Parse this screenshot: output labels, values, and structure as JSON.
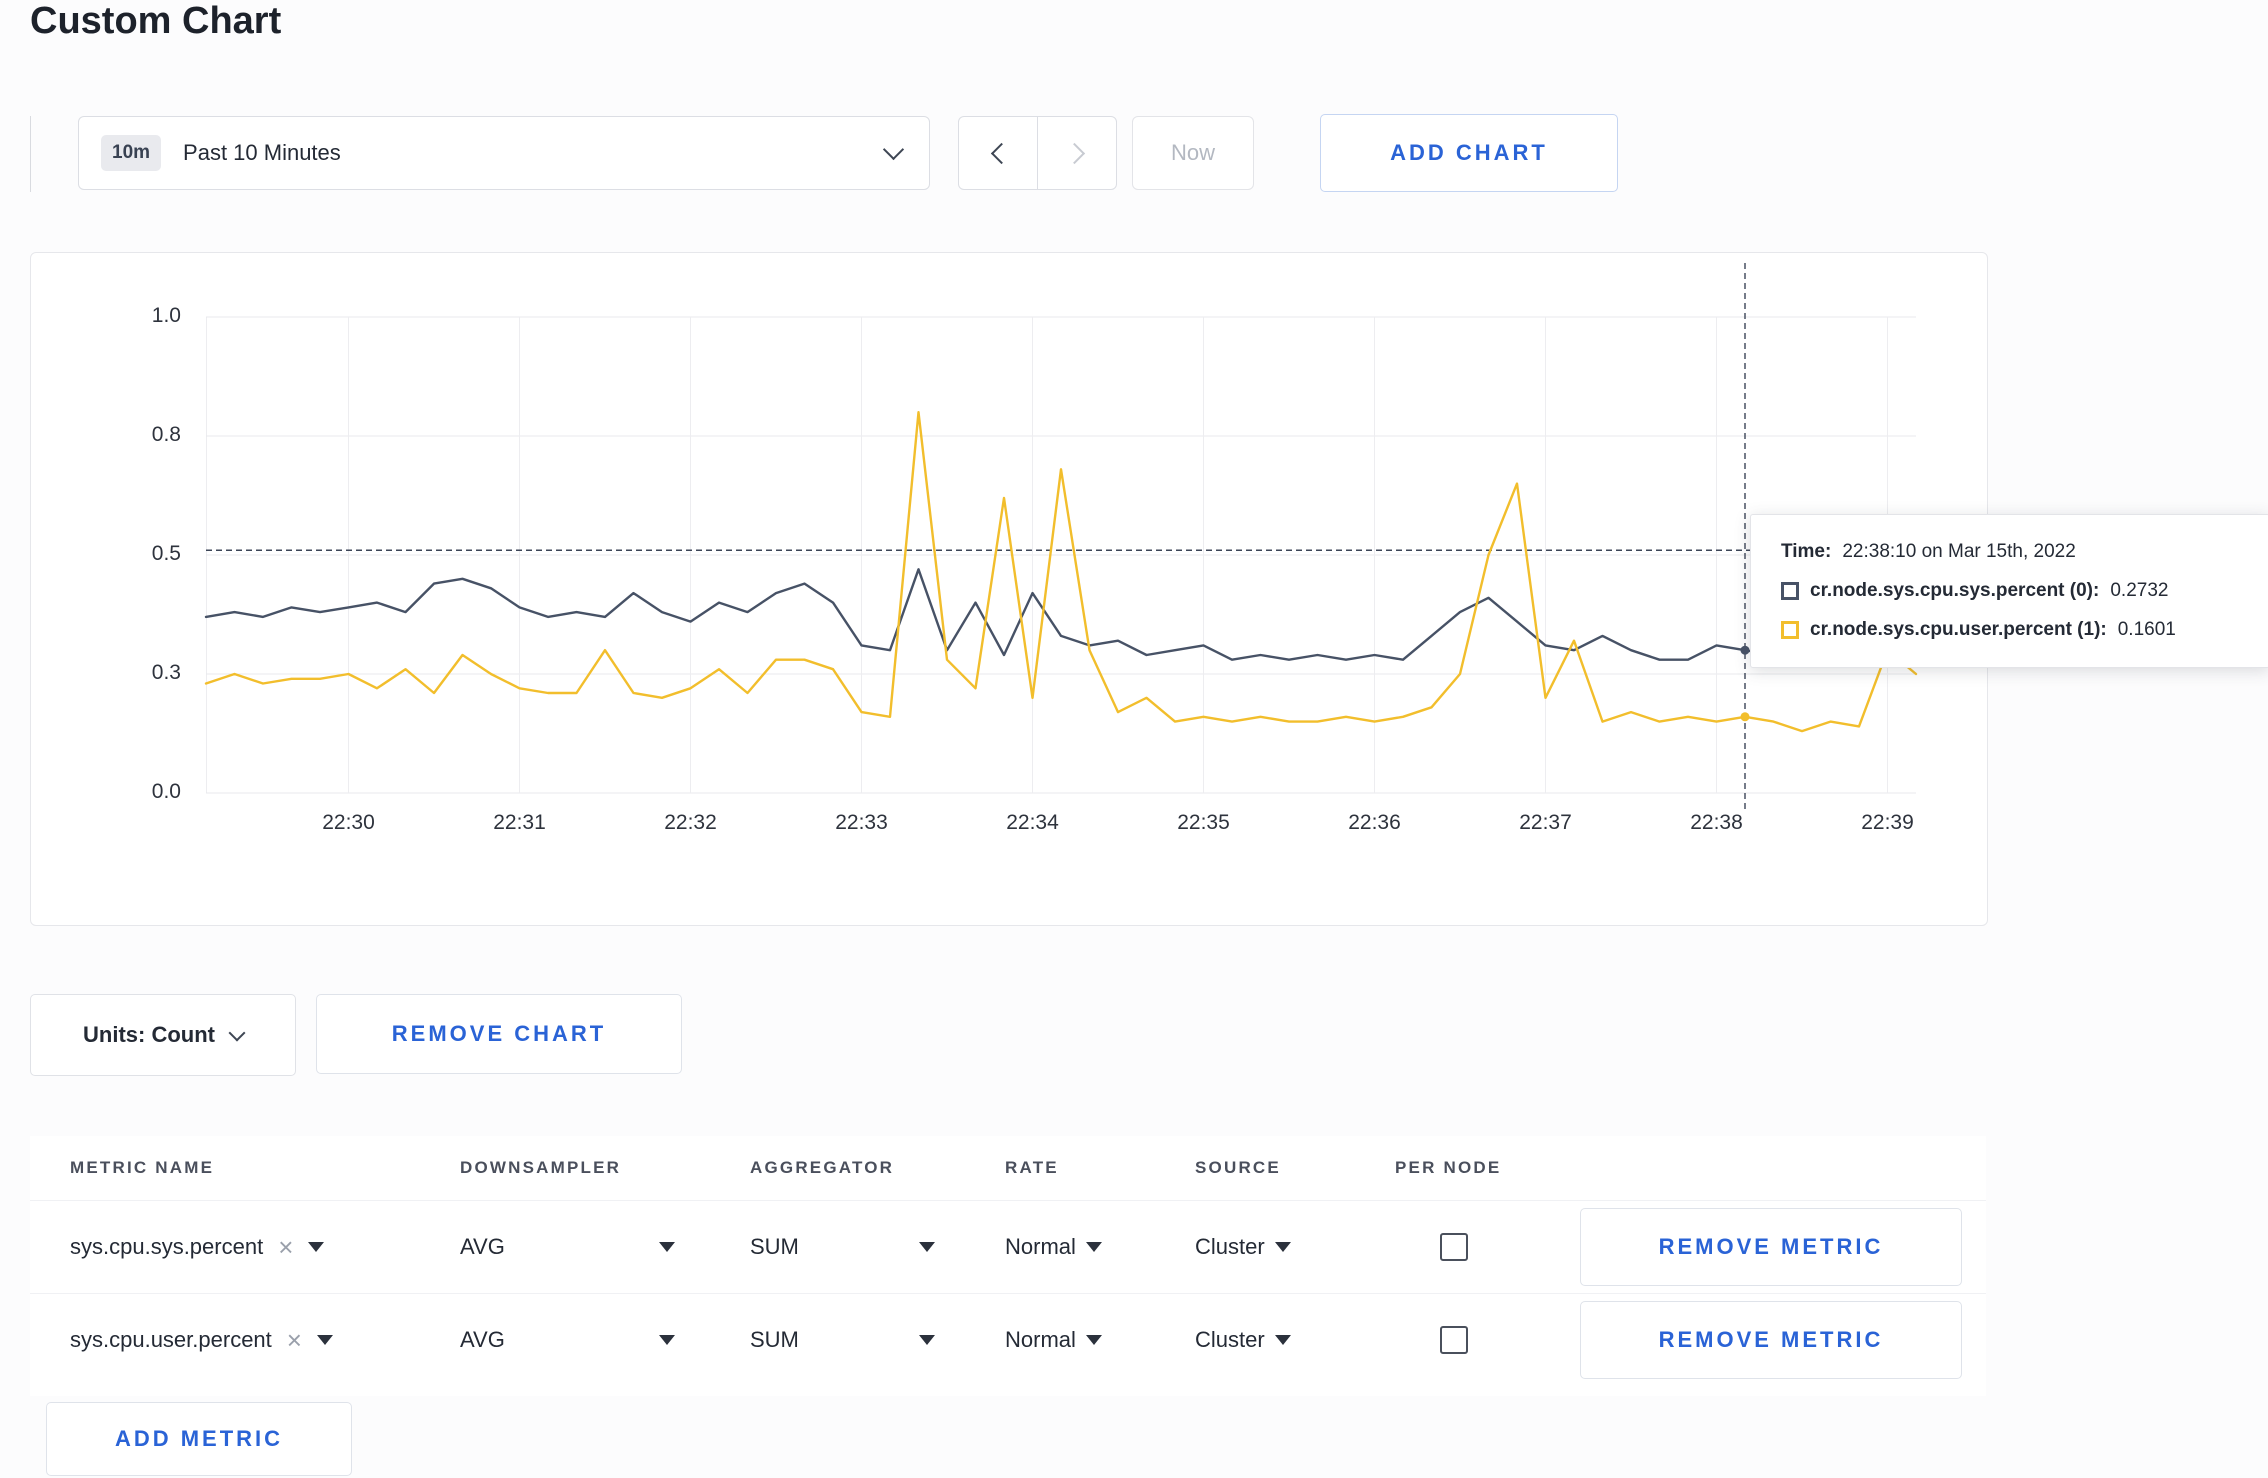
{
  "page": {
    "title": "Custom Chart"
  },
  "toolbar": {
    "time_badge": "10m",
    "time_label": "Past 10 Minutes",
    "now_label": "Now",
    "add_chart_label": "ADD CHART"
  },
  "chart_controls": {
    "units_label": "Units: Count",
    "remove_chart_label": "REMOVE CHART"
  },
  "chart_data": {
    "type": "line",
    "title": "",
    "xlabel": "",
    "ylabel": "",
    "ylim": [
      0,
      1
    ],
    "grid": true,
    "legend_position": "none",
    "x_start_time": "22:29:10",
    "x_interval_seconds": 10,
    "y_ticks": [
      {
        "v": 0,
        "label": "0.0"
      },
      {
        "v": 0.25,
        "label": "0.3"
      },
      {
        "v": 0.5,
        "label": "0.5"
      },
      {
        "v": 0.75,
        "label": "0.8"
      },
      {
        "v": 1,
        "label": "1.0"
      }
    ],
    "x_ticks": [
      {
        "i": 5,
        "label": "22:30"
      },
      {
        "i": 11,
        "label": "22:31"
      },
      {
        "i": 17,
        "label": "22:32"
      },
      {
        "i": 23,
        "label": "22:33"
      },
      {
        "i": 29,
        "label": "22:34"
      },
      {
        "i": 35,
        "label": "22:35"
      },
      {
        "i": 41,
        "label": "22:36"
      },
      {
        "i": 47,
        "label": "22:37"
      },
      {
        "i": 53,
        "label": "22:38"
      },
      {
        "i": 59,
        "label": "22:39"
      }
    ],
    "series": [
      {
        "name": "cr.node.sys.cpu.sys.percent",
        "color": "#475266",
        "values": [
          0.37,
          0.38,
          0.37,
          0.39,
          0.38,
          0.39,
          0.4,
          0.38,
          0.44,
          0.45,
          0.43,
          0.39,
          0.37,
          0.38,
          0.37,
          0.42,
          0.38,
          0.36,
          0.4,
          0.38,
          0.42,
          0.44,
          0.4,
          0.31,
          0.3,
          0.47,
          0.3,
          0.4,
          0.29,
          0.42,
          0.33,
          0.31,
          0.32,
          0.29,
          0.3,
          0.31,
          0.28,
          0.29,
          0.28,
          0.29,
          0.28,
          0.29,
          0.28,
          0.33,
          0.38,
          0.41,
          0.36,
          0.31,
          0.3,
          0.33,
          0.3,
          0.28,
          0.28,
          0.31,
          0.3,
          0.29,
          0.31,
          0.3,
          0.31,
          0.3,
          0.31
        ]
      },
      {
        "name": "cr.node.sys.cpu.user.percent",
        "color": "#f2be2c",
        "values": [
          0.23,
          0.25,
          0.23,
          0.24,
          0.24,
          0.25,
          0.22,
          0.26,
          0.21,
          0.29,
          0.25,
          0.22,
          0.21,
          0.21,
          0.3,
          0.21,
          0.2,
          0.22,
          0.26,
          0.21,
          0.28,
          0.28,
          0.26,
          0.17,
          0.16,
          0.8,
          0.28,
          0.22,
          0.62,
          0.2,
          0.68,
          0.3,
          0.17,
          0.2,
          0.15,
          0.16,
          0.15,
          0.16,
          0.15,
          0.15,
          0.16,
          0.15,
          0.16,
          0.18,
          0.25,
          0.5,
          0.65,
          0.2,
          0.32,
          0.15,
          0.17,
          0.15,
          0.16,
          0.15,
          0.16,
          0.15,
          0.13,
          0.15,
          0.14,
          0.3,
          0.25
        ]
      }
    ],
    "hover": {
      "index": 54,
      "crosshair_value": 0.51,
      "time_label": "Time:",
      "time": "22:38:10 on Mar 15th, 2022",
      "readings": [
        {
          "label": "cr.node.sys.cpu.sys.percent (0):",
          "value": "0.2732",
          "color": "#475266"
        },
        {
          "label": "cr.node.sys.cpu.user.percent (1):",
          "value": "0.1601",
          "color": "#f2be2c"
        }
      ]
    }
  },
  "metrics_table": {
    "headers": [
      "METRIC NAME",
      "DOWNSAMPLER",
      "AGGREGATOR",
      "RATE",
      "SOURCE",
      "PER NODE"
    ],
    "rows": [
      {
        "metric": "sys.cpu.sys.percent",
        "downsampler": "AVG",
        "aggregator": "SUM",
        "rate": "Normal",
        "source": "Cluster",
        "per_node_checked": false,
        "remove_label": "REMOVE METRIC"
      },
      {
        "metric": "sys.cpu.user.percent",
        "downsampler": "AVG",
        "aggregator": "SUM",
        "rate": "Normal",
        "source": "Cluster",
        "per_node_checked": false,
        "remove_label": "REMOVE METRIC"
      }
    ],
    "add_metric_label": "ADD METRIC"
  }
}
